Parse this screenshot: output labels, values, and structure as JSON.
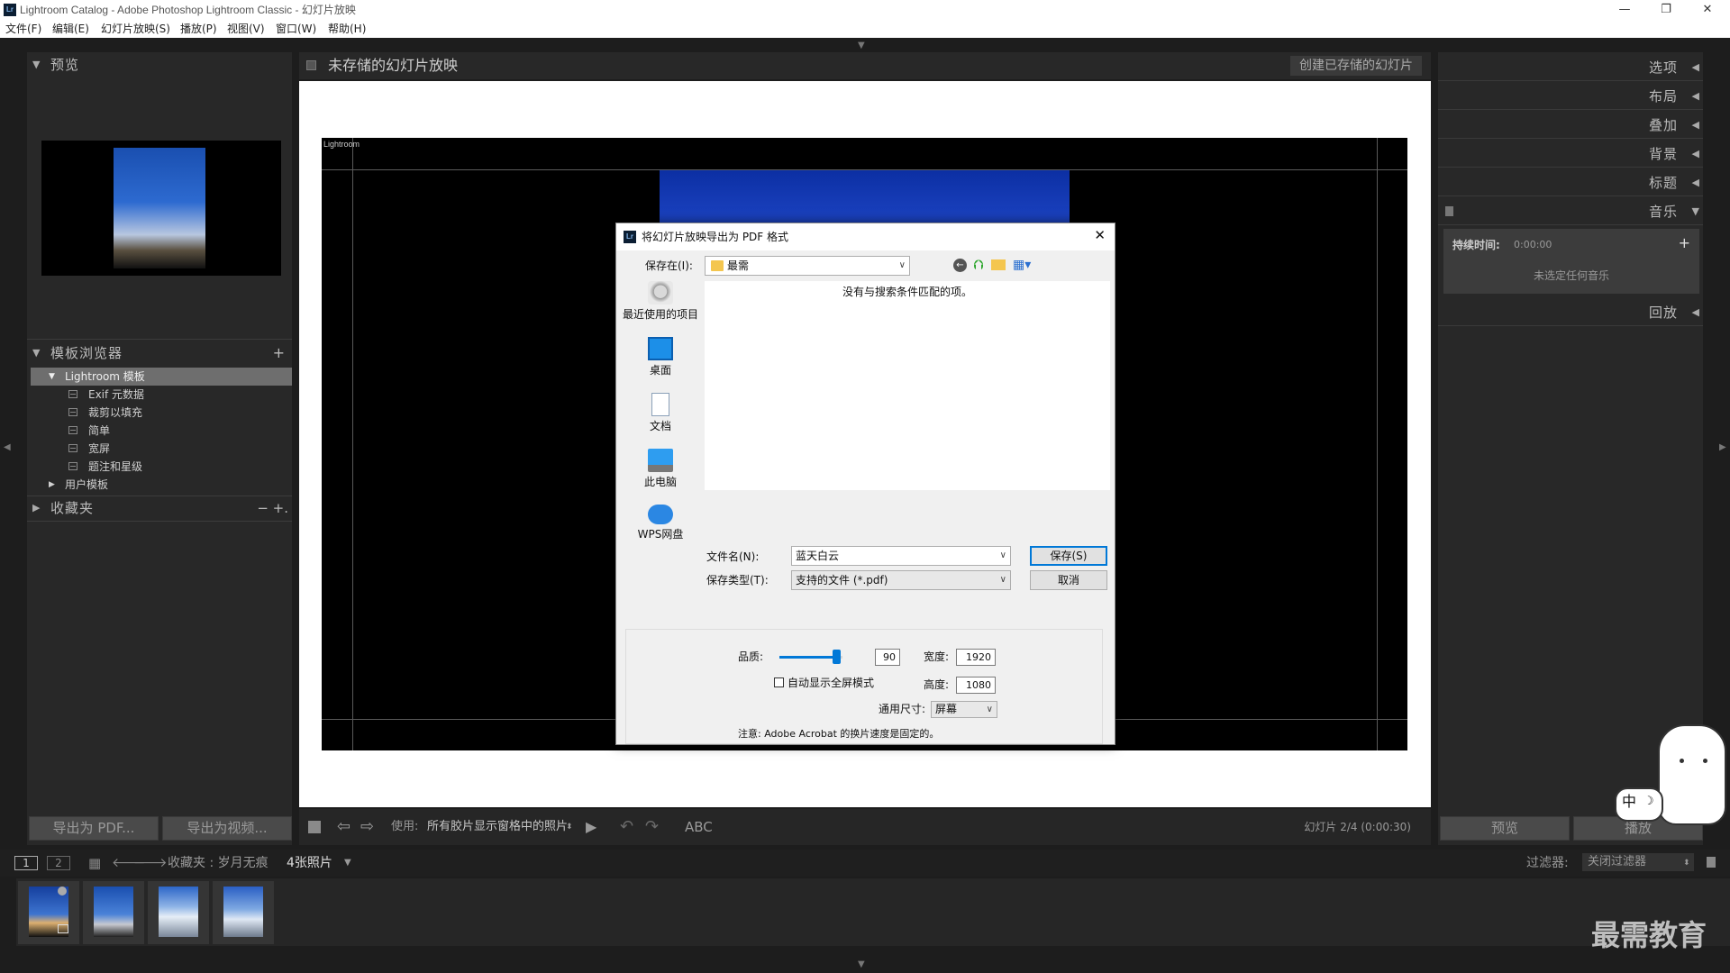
{
  "window": {
    "title": "Lightroom Catalog - Adobe Photoshop Lightroom Classic - 幻灯片放映",
    "app_icon": "Lr",
    "minimize": "—",
    "restore": "❐",
    "close": "✕"
  },
  "menu": [
    "文件(F)",
    "编辑(E)",
    "幻灯片放映(S)",
    "播放(P)",
    "视图(V)",
    "窗口(W)",
    "帮助(H)"
  ],
  "left_panel": {
    "preview_title": "预览",
    "template_browser_title": "模板浏览器",
    "template_add": "+",
    "templates": [
      {
        "label": "Lightroom 模板",
        "kind": "folder-open"
      },
      {
        "label": "Exif 元数据",
        "kind": "item"
      },
      {
        "label": "裁剪以填充",
        "kind": "item"
      },
      {
        "label": "简单",
        "kind": "item"
      },
      {
        "label": "宽屏",
        "kind": "item"
      },
      {
        "label": "题注和星级",
        "kind": "item"
      },
      {
        "label": "用户模板",
        "kind": "folder-closed"
      }
    ],
    "collections_title": "收藏夹",
    "collections_minus": "−",
    "collections_plus": "+.",
    "export_pdf": "导出为 PDF...",
    "export_video": "导出为视频..."
  },
  "center": {
    "slideshow_title": "未存储的幻灯片放映",
    "create_saved": "创建已存储的幻灯片",
    "slide_overlay_label": "Lightroom"
  },
  "toolbar": {
    "use_label": "使用:",
    "use_value": "所有胶片显示窗格中的照片",
    "abc": "ABC",
    "slide_counter": "幻灯片 2/4 (0:00:30)"
  },
  "right_panel": {
    "sections": [
      "选项",
      "布局",
      "叠加",
      "背景",
      "标题",
      "音乐"
    ],
    "music_duration_label": "持续时间:",
    "music_duration_value": "0:00:00",
    "music_add": "+",
    "music_empty": "未选定任何音乐",
    "playback": "回放",
    "preview_button": "预览",
    "play_button": "播放"
  },
  "filmstrip": {
    "page1": "1",
    "page2": "2",
    "source": "收藏夹 : 岁月无痕",
    "count": "4张照片",
    "filter_label": "过滤器:",
    "filter_value": "关闭过滤器"
  },
  "dialog": {
    "title": "将幻灯片放映导出为 PDF 格式",
    "close": "✕",
    "save_in_label": "保存在(I):",
    "save_in_value": "最需",
    "places": [
      "最近使用的项目",
      "桌面",
      "文档",
      "此电脑",
      "WPS网盘"
    ],
    "empty_message": "没有与搜索条件匹配的项。",
    "filename_label": "文件名(N):",
    "filename_value": "蓝天白云",
    "filetype_label": "保存类型(T):",
    "filetype_value": "支持的文件 (*.pdf)",
    "save_button": "保存(S)",
    "cancel_button": "取消",
    "quality_label": "品质:",
    "quality_value": "90",
    "quality_fraction": 0.9,
    "width_label": "宽度:",
    "width_value": "1920",
    "height_label": "高度:",
    "height_value": "1080",
    "fullscreen_label": "自动显示全屏模式",
    "common_size_label": "通用尺寸:",
    "common_size_value": "屏幕",
    "note": "注意:  Adobe Acrobat 的换片速度是固定的。"
  },
  "ime": {
    "label": "中"
  },
  "watermark": "最需教育",
  "colors": {
    "panel_bg": "#282828",
    "app_bg": "#1d1d1d",
    "dialog_bg": "#f0f0f0",
    "accent": "#0078d7",
    "selected_row": "#6e6e6e"
  }
}
